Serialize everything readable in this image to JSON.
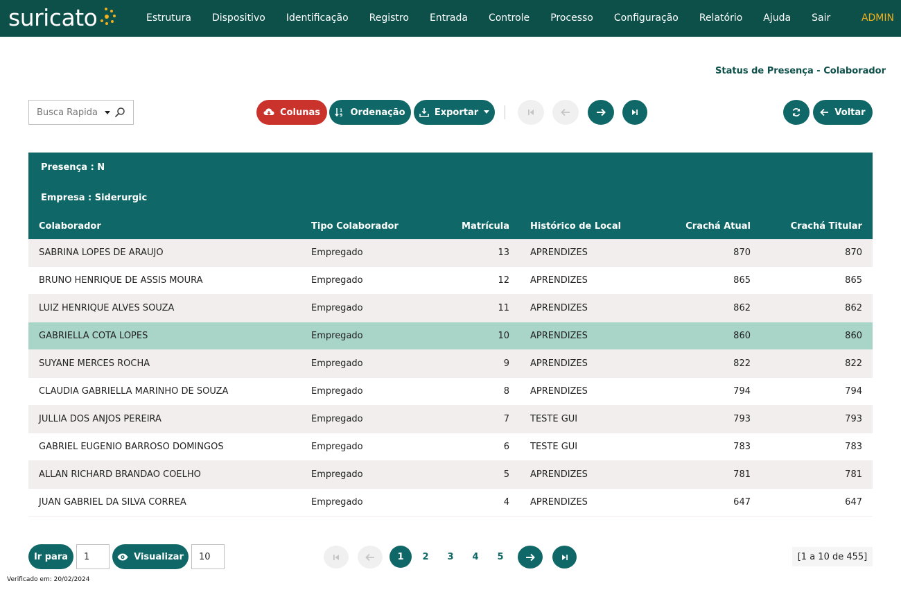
{
  "app": {
    "logo_text": "suricato",
    "user": "ADMIN",
    "nav": [
      "Estrutura",
      "Dispositivo",
      "Identificação",
      "Registro",
      "Entrada",
      "Controle",
      "Processo",
      "Configuração",
      "Relatório",
      "Ajuda",
      "Sair"
    ]
  },
  "page_title": "Status de Presença - Colaborador",
  "toolbar": {
    "search_placeholder": "Busca Rapida",
    "columns_label": "Colunas",
    "order_label": "Ordenação",
    "export_label": "Exportar",
    "back_label": "Voltar"
  },
  "group": {
    "presence": "Presença : N",
    "company": "Empresa : Siderurgic"
  },
  "table": {
    "headers": [
      "Colaborador",
      "Tipo Colaborador",
      "Matrícula",
      "Histórico de Local",
      "Crachá Atual",
      "Crachá Titular"
    ],
    "rows": [
      [
        "SABRINA LOPES DE ARAUJO",
        "Empregado",
        "13",
        "APRENDIZES",
        "870",
        "870"
      ],
      [
        "BRUNO HENRIQUE DE ASSIS MOURA",
        "Empregado",
        "12",
        "APRENDIZES",
        "865",
        "865"
      ],
      [
        "LUIZ HENRIQUE ALVES SOUZA",
        "Empregado",
        "11",
        "APRENDIZES",
        "862",
        "862"
      ],
      [
        "GABRIELLA COTA LOPES",
        "Empregado",
        "10",
        "APRENDIZES",
        "860",
        "860"
      ],
      [
        "SUYANE MERCES ROCHA",
        "Empregado",
        "9",
        "APRENDIZES",
        "822",
        "822"
      ],
      [
        "CLAUDIA GABRIELLA MARINHO DE SOUZA",
        "Empregado",
        "8",
        "APRENDIZES",
        "794",
        "794"
      ],
      [
        "JULLIA DOS ANJOS PEREIRA",
        "Empregado",
        "7",
        "TESTE GUI",
        "793",
        "793"
      ],
      [
        "GABRIEL EUGENIO BARROSO DOMINGOS",
        "Empregado",
        "6",
        "TESTE GUI",
        "783",
        "783"
      ],
      [
        "ALLAN RICHARD BRANDAO COELHO",
        "Empregado",
        "5",
        "APRENDIZES",
        "781",
        "781"
      ],
      [
        "JUAN GABRIEL DA SILVA CORREA",
        "Empregado",
        "4",
        "APRENDIZES",
        "647",
        "647"
      ]
    ],
    "selected_row": 3
  },
  "pagination": {
    "goto_label": "Ir para",
    "goto_value": "1",
    "view_label": "Visualizar",
    "page_size": "10",
    "pages": [
      "1",
      "2",
      "3",
      "4",
      "5"
    ],
    "current_page": "1",
    "range_text": "[1 a 10 de 455]"
  },
  "footer": {
    "verified": "Verificado em: 20/02/2024"
  },
  "colors": {
    "topbar": "#0d4f49",
    "primary": "#0f6767",
    "accent": "#f2b01c",
    "danger": "#c9332c",
    "row_alt": "#f3eeee",
    "row_selected": "#a9d4c8"
  }
}
